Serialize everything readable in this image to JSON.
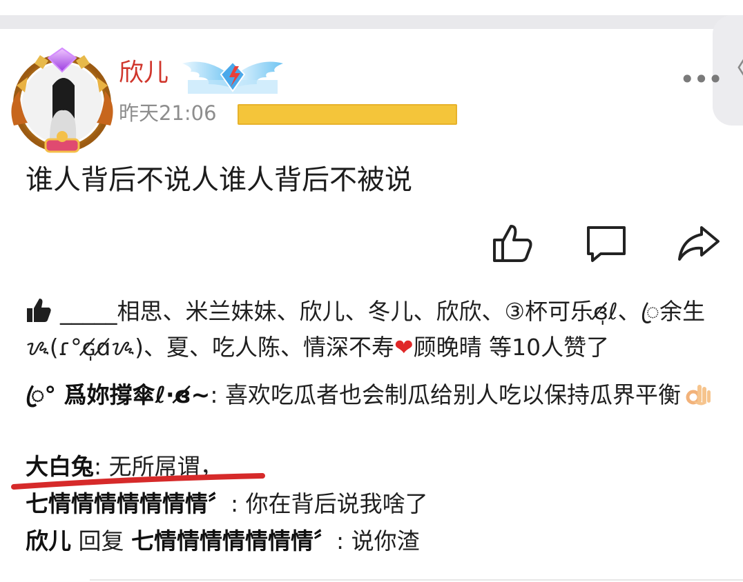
{
  "post": {
    "author_name": "欣儿",
    "time": "昨天21:06",
    "content": "谁人背后不说人谁人背后不被说"
  },
  "likes": {
    "names": "_____相思、米兰妹妹、欣儿、冬儿、欣欣、③杯可乐ɞ̸̩ℓ、ꦿ余生ᝰ(ɾ°ɢ̸̩ɑ̸ᝰ)、夏、吃人陈、情深不寿",
    "last_name": "顾晚晴",
    "suffix": "等10人赞了"
  },
  "comments": [
    {
      "author": "ꦿ° 爲妳撐傘ℓ·ɞ̸~",
      "separator": ": ",
      "text": "喜欢吃瓜者也会制瓜给别人吃以保持瓜界平衡"
    },
    {
      "author": "大白兔",
      "separator": ": ",
      "text": "无所屌谓，"
    },
    {
      "author": "七情情情情情情情〞",
      "separator": ": ",
      "text": "你在背后说我啥了"
    },
    {
      "author": "欣儿",
      "reply_word": "回复",
      "reply_to": "七情情情情情情情〞",
      "separator": ": ",
      "text": "说你渣"
    }
  ],
  "icons": {
    "more": "more-dots-icon",
    "like": "thumbs-up-icon",
    "comment": "comment-bubble-icon",
    "share": "share-arrow-icon",
    "side": "chevron-left-icon"
  },
  "colors": {
    "author_name": "#d0362c",
    "timestamp": "#8d8d8d",
    "highlight_bar": "#f4c53a",
    "annotation_underline": "#d62a2a",
    "heart": "#e02828"
  }
}
